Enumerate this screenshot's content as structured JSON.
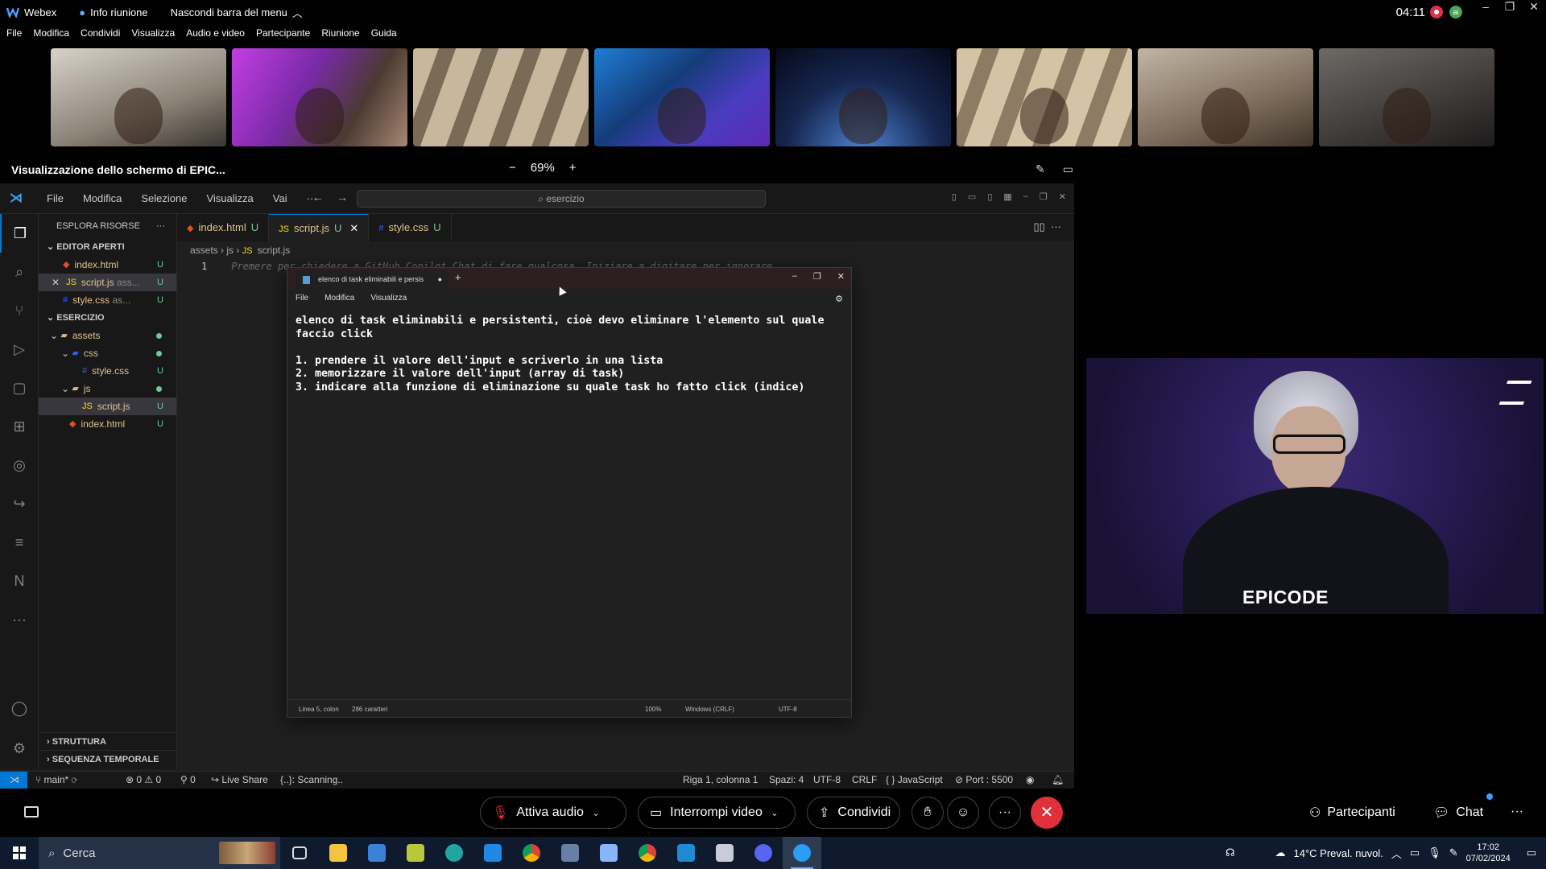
{
  "webex": {
    "app_name": "Webex",
    "meeting_info": "Info riunione",
    "hide_menu": "Nascondi barra del menu",
    "timer": "04:11",
    "menu": [
      "File",
      "Modifica",
      "Condividi",
      "Visualizza",
      "Audio e video",
      "Partecipante",
      "Riunione",
      "Guida"
    ],
    "share_label": "Visualizzazione dello schermo di EPIC...",
    "zoom": "69%",
    "controls": {
      "audio": "Attiva audio",
      "video": "Interrompi video",
      "share": "Condividi",
      "participants": "Partecipanti",
      "chat": "Chat"
    },
    "presenter_brand": "EPICODE"
  },
  "vscode": {
    "menu": [
      "File",
      "Modifica",
      "Selezione",
      "Visualizza",
      "Vai",
      "···"
    ],
    "search": "esercizio",
    "explorer_title": "ESPLORA RISORSE",
    "open_editors_title": "EDITOR APERTI",
    "open_editors": [
      {
        "name": "index.html",
        "badge": "U"
      },
      {
        "name": "script.js",
        "extra": "ass...",
        "badge": "U"
      },
      {
        "name": "style.css",
        "extra": "as...",
        "badge": "U"
      }
    ],
    "project_title": "ESERCIZIO",
    "tree": {
      "assets": "assets",
      "css": "css",
      "style": "style.css",
      "js": "js",
      "script": "script.js",
      "index": "index.html",
      "badge": "U"
    },
    "outline": "STRUTTURA",
    "timeline": "SEQUENZA TEMPORALE",
    "tabs": [
      {
        "name": "index.html",
        "badge": "U"
      },
      {
        "name": "script.js",
        "badge": "U"
      },
      {
        "name": "style.css",
        "badge": "U"
      }
    ],
    "breadcrumb": [
      "assets",
      "js",
      "script.js"
    ],
    "line_number": "1",
    "hint_text": "Premere",
    "hint_rest": "per chiedere a GitHub Copilot Chat di fare qualcosa. Iniziare a digitare per ignorare.",
    "status": {
      "branch": "main*",
      "errors": "0",
      "warnings": "0",
      "ports": "0",
      "live_share": "Live Share",
      "scanning": "{..}: Scanning..",
      "position": "Riga 1, colonna 1",
      "spaces": "Spazi: 4",
      "encoding": "UTF-8",
      "eol": "CRLF",
      "language": "JavaScript",
      "port": "Port : 5500"
    }
  },
  "notepad": {
    "tab_title": "elenco di task eliminabili e persis",
    "menu": [
      "File",
      "Modifica",
      "Visualizza"
    ],
    "content": "elenco di task eliminabili e persistenti, cioè devo eliminare l'elemento sul quale\nfaccio click\n\n1. prendere il valore dell'input e scriverlo in una lista\n2. memorizzare il valore dell'input (array di task)\n3. indicare alla funzione di eliminazione su quale task ho fatto click (indice)",
    "status": {
      "position": "Linea 5, colon",
      "chars": "286 caratteri",
      "zoom": "100%",
      "eol": "Windows (CRLF)",
      "encoding": "UTF-8"
    }
  },
  "taskbar": {
    "search": "Cerca",
    "weather": "14°C  Preval. nuvol.",
    "time": "17:02",
    "date": "07/02/2024"
  }
}
